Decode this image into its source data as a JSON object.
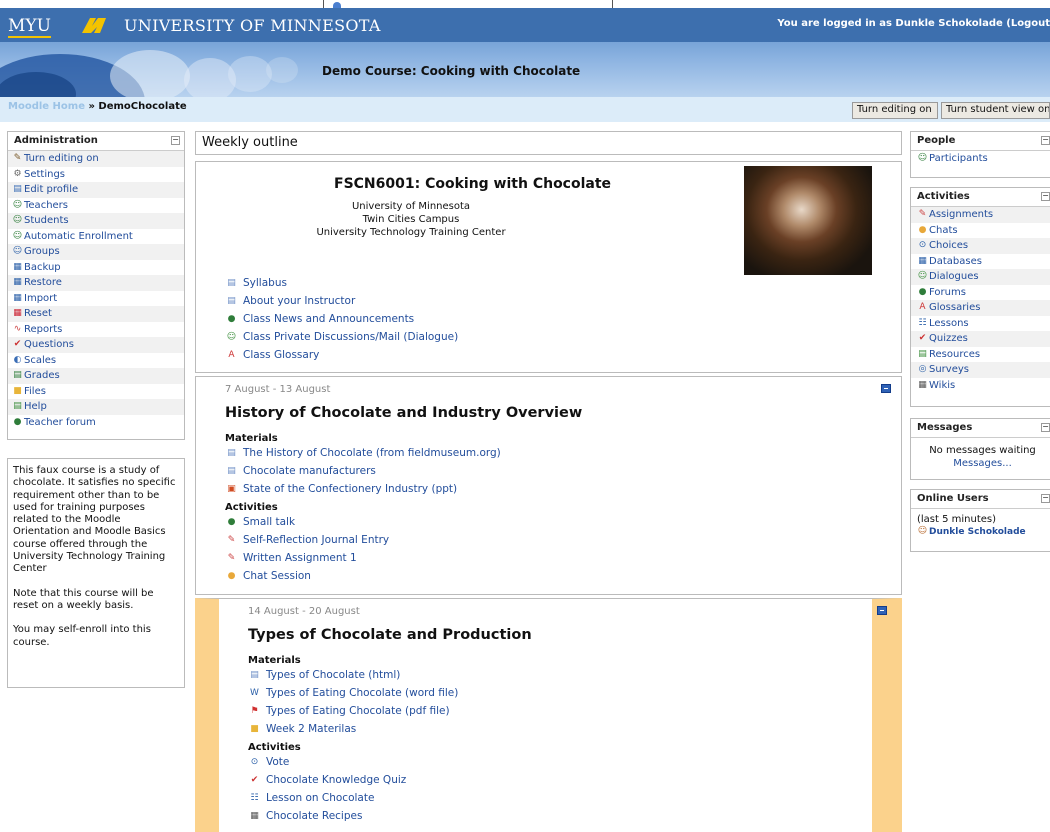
{
  "header": {
    "myu_label": "MYU",
    "university_name": "UNIVERSITY OF MINNESOTA",
    "login_text": "You are logged in as Dunkle Schokolade (Logout",
    "course_name": "Demo Course: Cooking with Chocolate"
  },
  "navbar": {
    "home_link": "Moodle Home",
    "separator": "»",
    "current": "DemoChocolate",
    "edit_button": "Turn editing on",
    "student_view_button": "Turn student view on"
  },
  "admin": {
    "title": "Administration",
    "items": [
      {
        "label": "Turn editing on",
        "icon": "edit-icon"
      },
      {
        "label": "Settings",
        "icon": "settings-icon"
      },
      {
        "label": "Edit profile",
        "icon": "profile-icon"
      },
      {
        "label": "Teachers",
        "icon": "users-icon"
      },
      {
        "label": "Students",
        "icon": "users-icon"
      },
      {
        "label": "Automatic Enrollment",
        "icon": "users-icon"
      },
      {
        "label": "Groups",
        "icon": "groups-icon"
      },
      {
        "label": "Backup",
        "icon": "backup-icon"
      },
      {
        "label": "Restore",
        "icon": "restore-icon"
      },
      {
        "label": "Import",
        "icon": "import-icon"
      },
      {
        "label": "Reset",
        "icon": "reset-icon"
      },
      {
        "label": "Reports",
        "icon": "reports-icon"
      },
      {
        "label": "Questions",
        "icon": "questions-icon"
      },
      {
        "label": "Scales",
        "icon": "scales-icon"
      },
      {
        "label": "Grades",
        "icon": "grades-icon"
      },
      {
        "label": "Files",
        "icon": "folder-icon"
      },
      {
        "label": "Help",
        "icon": "help-icon"
      },
      {
        "label": "Teacher forum",
        "icon": "forum-icon"
      }
    ]
  },
  "description": {
    "p1": "This faux course is a study of chocolate. It satisfies no specific requirement other than to be used for training purposes related to the Moodle Orientation and Moodle Basics course offered through the University Technology Training Center",
    "p2": "Note that this course will be reset on a weekly basis.",
    "p3": "You may self-enroll into this course."
  },
  "main": {
    "heading": "Weekly outline",
    "section0": {
      "title": "FSCN6001: Cooking with Chocolate",
      "lines": [
        "University of Minnesota",
        "Twin Cities Campus",
        "University Technology Training Center"
      ],
      "resources": [
        {
          "label": "Syllabus",
          "icon": "document-icon"
        },
        {
          "label": "About your Instructor",
          "icon": "document-icon"
        },
        {
          "label": "Class News and Announcements",
          "icon": "forum-icon"
        },
        {
          "label": "Class Private Discussions/Mail (Dialogue)",
          "icon": "dialogue-icon"
        },
        {
          "label": "Class Glossary",
          "icon": "glossary-icon"
        }
      ]
    },
    "week1": {
      "dates": "7 August - 13 August",
      "title": "History of Chocolate and Industry Overview",
      "materials_label": "Materials",
      "materials": [
        {
          "label": "The History of Chocolate (from fieldmuseum.org)",
          "icon": "document-icon"
        },
        {
          "label": "Chocolate manufacturers",
          "icon": "document-icon"
        },
        {
          "label": "State of the Confectionery Industry (ppt)",
          "icon": "ppt-icon"
        }
      ],
      "activities_label": "Activities",
      "activities": [
        {
          "label": "Small talk",
          "icon": "forum-icon"
        },
        {
          "label": "Self-Reflection Journal Entry",
          "icon": "journal-icon"
        },
        {
          "label": "Written Assignment 1",
          "icon": "assignment-icon"
        },
        {
          "label": "Chat Session",
          "icon": "chat-icon"
        }
      ]
    },
    "week2": {
      "dates": "14 August - 20 August",
      "title": "Types of Chocolate and Production",
      "materials_label": "Materials",
      "materials": [
        {
          "label": "Types of Chocolate (html)",
          "icon": "document-icon"
        },
        {
          "label": "Types of Eating Chocolate (word file)",
          "icon": "word-icon"
        },
        {
          "label": "Types of Eating Chocolate (pdf file)",
          "icon": "pdf-icon"
        },
        {
          "label": "Week 2 Materilas",
          "icon": "folder-icon"
        }
      ],
      "activities_label": "Activities",
      "activities": [
        {
          "label": "Vote",
          "icon": "choice-icon"
        },
        {
          "label": "Chocolate Knowledge Quiz",
          "icon": "quiz-icon"
        },
        {
          "label": "Lesson on Chocolate",
          "icon": "lesson-icon"
        },
        {
          "label": "Chocolate Recipes",
          "icon": "wiki-icon"
        }
      ]
    }
  },
  "people": {
    "title": "People",
    "items": [
      {
        "label": "Participants",
        "icon": "users-icon"
      }
    ]
  },
  "activities": {
    "title": "Activities",
    "items": [
      {
        "label": "Assignments",
        "icon": "assignment-icon"
      },
      {
        "label": "Chats",
        "icon": "chat-icon"
      },
      {
        "label": "Choices",
        "icon": "choice-icon"
      },
      {
        "label": "Databases",
        "icon": "database-icon"
      },
      {
        "label": "Dialogues",
        "icon": "dialogue-icon"
      },
      {
        "label": "Forums",
        "icon": "forum-icon"
      },
      {
        "label": "Glossaries",
        "icon": "glossary-icon"
      },
      {
        "label": "Lessons",
        "icon": "lesson-icon"
      },
      {
        "label": "Quizzes",
        "icon": "quiz-icon"
      },
      {
        "label": "Resources",
        "icon": "resource-icon"
      },
      {
        "label": "Surveys",
        "icon": "survey-icon"
      },
      {
        "label": "Wikis",
        "icon": "wiki-icon"
      }
    ]
  },
  "messages": {
    "title": "Messages",
    "status": "No messages waiting",
    "link": "Messages..."
  },
  "online": {
    "title": "Online Users",
    "note": "(last 5 minutes)",
    "users": [
      {
        "label": "Dunkle Schokolade",
        "icon": "user-icon"
      }
    ]
  }
}
